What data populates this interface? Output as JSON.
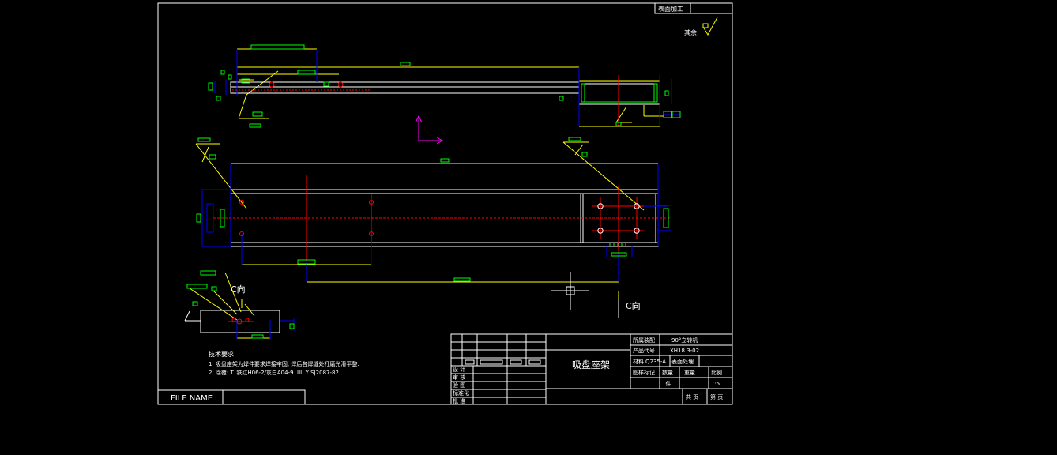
{
  "colors": {
    "background": "#000000",
    "frame": "#ffffff",
    "outline": "#ffffff",
    "dimension": "#ffff00",
    "centerline": "#ff0000",
    "hidden": "#0000ff",
    "annotation_box": "#00ff00",
    "arrow": "#ff00ff"
  },
  "surface_table": {
    "label": "表面加工",
    "remainder": "其余:"
  },
  "view_labels": {
    "view_c_1": "C向",
    "view_c_2": "C向"
  },
  "tech_requirements": {
    "heading": "技术要求",
    "line1": "1. 吸盘座架为焊件要求焊接牢固, 焊后各焊缝处打磨光滑平整.",
    "line2": "2. 涂覆: T. 铁红H06-2/灰白A04-9. III. Y SJ2087-82."
  },
  "file_name": "FILE NAME",
  "title_block": {
    "drawing_title": "吸盘座架",
    "assembly_label": "所属装配",
    "assembly_value": "90°立转机",
    "product_code_label": "产品代号",
    "product_code_value": "XH18.3-02",
    "material_label": "材料",
    "material_value": "Q235-A",
    "surface_treatment_label": "表面处理",
    "marking_label": "图样标记",
    "quantity_label": "数量",
    "weight_label": "重量",
    "ratio_label": "比例",
    "quantity_value": "1件",
    "ratio_value": "1:5",
    "total_pages_label": "共 页",
    "page_label": "第 页",
    "sign_rows": [
      "设 计",
      "审 核",
      "验 图",
      "标准化",
      "批 准"
    ]
  }
}
